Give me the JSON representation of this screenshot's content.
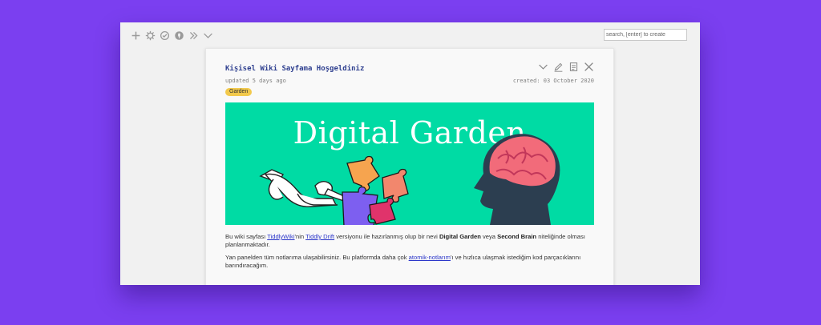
{
  "search": {
    "placeholder": "search, [enter] to create"
  },
  "toolbar": {
    "icons": [
      "plus-icon",
      "gear-icon",
      "check-circle-icon",
      "lock-icon",
      "double-chevron-icon",
      "chevron-down-icon"
    ]
  },
  "tiddler": {
    "title": "Kişisel Wiki Sayfama Hoşgeldiniz",
    "updated": "updated 5 days ago",
    "created": "created: 03 October 2020",
    "tag": "Garden",
    "banner_title": "Digital Garden",
    "paragraph1": {
      "t1": "Bu wiki sayfası ",
      "link1": "TiddlyWiki",
      "t2": "'nin ",
      "link2": "Tiddly Drift",
      "t3": " versiyonu ile hazırlanmış olup bir nevi ",
      "b1": "Digital Garden",
      "t4": " veya ",
      "b2": "Second Brain",
      "t5": " niteliğinde olması planlanmaktadır."
    },
    "paragraph2": {
      "t1": "Yan panelden tüm notlarıma ulaşabilirsiniz. Bu platformda daha çok ",
      "link1": "atomik-notlarım",
      "t2": "'ı ve hızlıca ulaşmak istediğim kod parçacıklarını barındıracağım."
    }
  },
  "colors": {
    "background": "#7b3ff0",
    "banner": "#00dba4",
    "title": "#2e3f8f",
    "tag": "#f2c94c"
  }
}
